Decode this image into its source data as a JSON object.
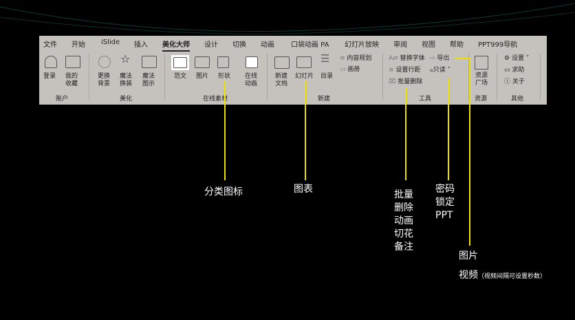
{
  "tabs": [
    "文件",
    "开始",
    "iSlide",
    "插入",
    "美化大师",
    "设计",
    "切换",
    "动画",
    "口袋动画 PA",
    "幻灯片放映",
    "审阅",
    "视图",
    "帮助",
    "PPT999导航"
  ],
  "active_tab": "美化大师",
  "groups": {
    "account": {
      "label": "账户",
      "items": [
        "登录",
        "我的\n收藏"
      ]
    },
    "beautify": {
      "label": "美化",
      "items": [
        "更换\n背景",
        "魔法\n换装",
        "魔法\n图示"
      ]
    },
    "online": {
      "label": "在线素材",
      "items": [
        "范文",
        "图片",
        "形状",
        "在线\n动画"
      ]
    },
    "new": {
      "label": "新建",
      "items": [
        "新建\n文档",
        "幻灯片",
        "目录",
        "内容规划",
        "画册"
      ]
    },
    "tools": {
      "label": "工具",
      "items": [
        "替换字体",
        "设置行距",
        "批量删除",
        "导出",
        "只读"
      ]
    },
    "resource": {
      "label": "资源",
      "items": [
        "资源\n广场"
      ]
    },
    "other": {
      "label": "其他",
      "items": [
        "设置",
        "求助",
        "关于"
      ]
    }
  },
  "annotations": {
    "category_icons": "分类图标",
    "chart": "图表",
    "batch_delete": [
      "批量",
      "删除",
      "动画",
      "切花",
      "备注"
    ],
    "password": [
      "密码",
      "锁定",
      "PPT"
    ],
    "image": "图片",
    "video": "视频",
    "video_note": "（视频间隔可设置秒数）"
  },
  "colors": {
    "background": "#000000",
    "ribbon": "#c5c2bd",
    "callout": "#f0e000"
  }
}
